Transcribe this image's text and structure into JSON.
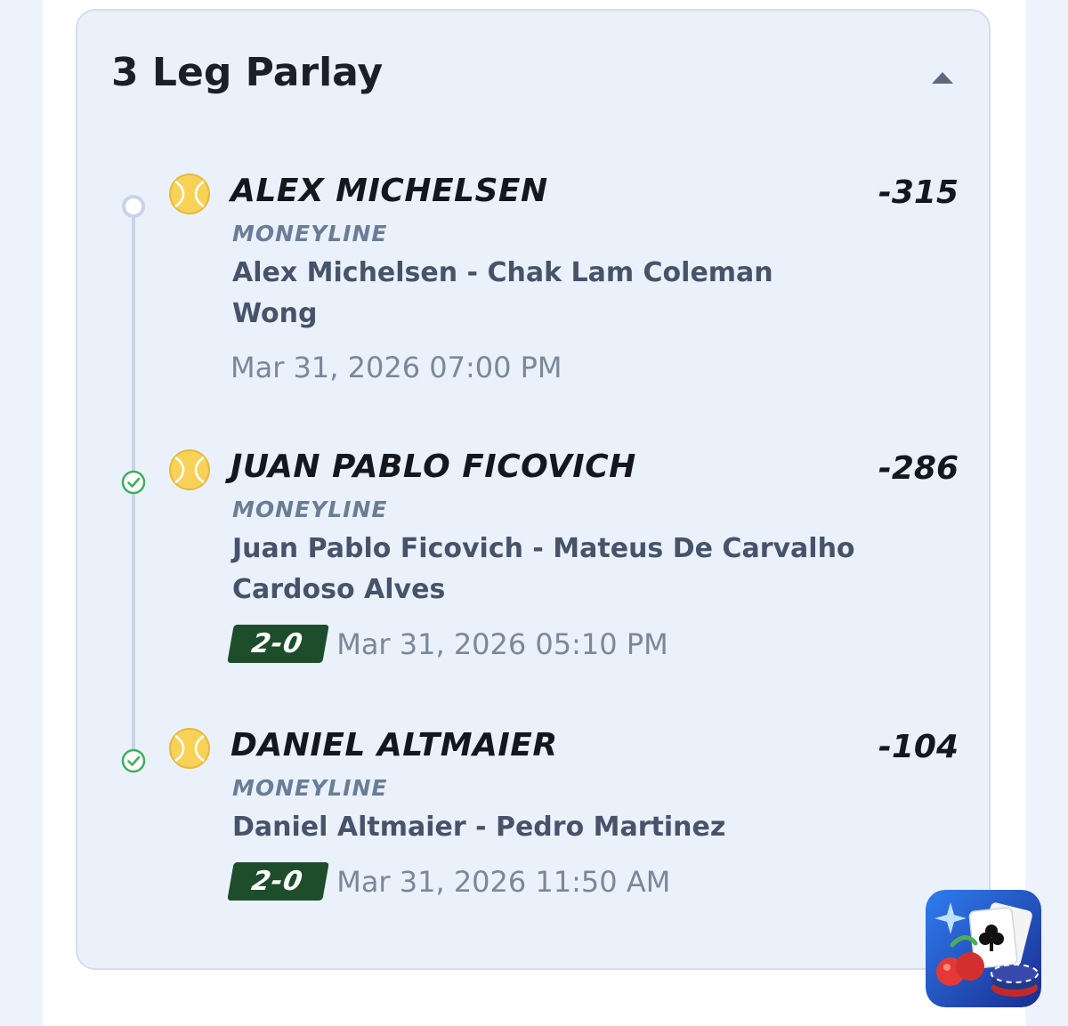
{
  "card": {
    "title": "3 Leg Parlay",
    "collapse_icon": "chevron-up-icon"
  },
  "legs": [
    {
      "status": "pending",
      "sport_icon": "tennis-ball-icon",
      "name": "ALEX MICHELSEN",
      "odds": "-315",
      "market": "MONEYLINE",
      "matchup": "Alex Michelsen - Chak Lam Coleman Wong",
      "score": "",
      "date": "Mar 31, 2026 07:00 PM"
    },
    {
      "status": "won",
      "sport_icon": "tennis-ball-icon",
      "name": "JUAN PABLO FICOVICH",
      "odds": "-286",
      "market": "MONEYLINE",
      "matchup": "Juan Pablo Ficovich - Mateus De Carvalho Cardoso Alves",
      "score": "2-0",
      "date": "Mar 31, 2026 05:10 PM"
    },
    {
      "status": "won",
      "sport_icon": "tennis-ball-icon",
      "name": "DANIEL ALTMAIER",
      "odds": "-104",
      "market": "MONEYLINE",
      "matchup": "Daniel Altmaier - Pedro Martinez",
      "score": "2-0",
      "date": "Mar 31, 2026 11:50 AM"
    }
  ],
  "colors": {
    "won": "#3fae5a",
    "pending": "#c8d4e6",
    "score_badge": "#1d4d2b"
  },
  "app_badge_icon": "casino-app-icon"
}
